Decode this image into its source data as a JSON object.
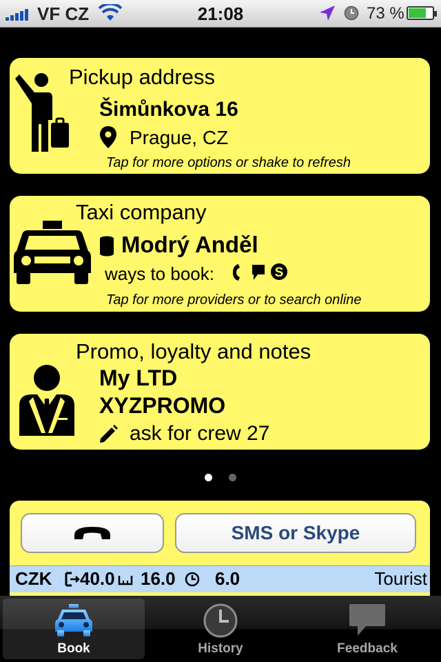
{
  "status_bar": {
    "carrier": "VF CZ",
    "time": "21:08",
    "battery": "73 %",
    "battery_level": 0.73,
    "icons": [
      "signal-icon",
      "wifi-icon",
      "location-icon",
      "alarm-icon",
      "battery-icon"
    ]
  },
  "pickup": {
    "heading": "Pickup address",
    "street": "Šimůnkova 16",
    "city": "Prague, CZ",
    "hint": "Tap for more options or shake to refresh",
    "icon": "hailing-passenger-icon"
  },
  "taxi": {
    "heading": "Taxi company",
    "company": "Modrý Anděl",
    "ways_label": "ways to book:",
    "hint": "Tap for more providers or to search online",
    "icon": "taxi-car-icon"
  },
  "promo": {
    "heading": "Promo, loyalty and notes",
    "name": "My LTD",
    "code": "XYZPROMO",
    "note": "ask for crew 27",
    "icon": "business-person-icon"
  },
  "pager": {
    "pages": 2,
    "current": 1
  },
  "actions": {
    "sms_label": "SMS or Skype",
    "call_icon": "phone-handset-icon"
  },
  "fare": {
    "currency": "CZK",
    "start": "40.0",
    "per_km": "16.0",
    "per_min": "6.0",
    "tariff": "Tourist"
  },
  "tabs": [
    {
      "label": "Book",
      "icon": "taxi-icon",
      "selected": true
    },
    {
      "label": "History",
      "icon": "clock-icon",
      "selected": false
    },
    {
      "label": "Feedback",
      "icon": "speech-bubble-icon",
      "selected": false
    }
  ],
  "colors": {
    "card_yellow": "#fff86a",
    "fare_blue": "#bcd9f7",
    "tab_selected_blue": "#4aa8ff",
    "button_text": "#2a4a7c"
  }
}
